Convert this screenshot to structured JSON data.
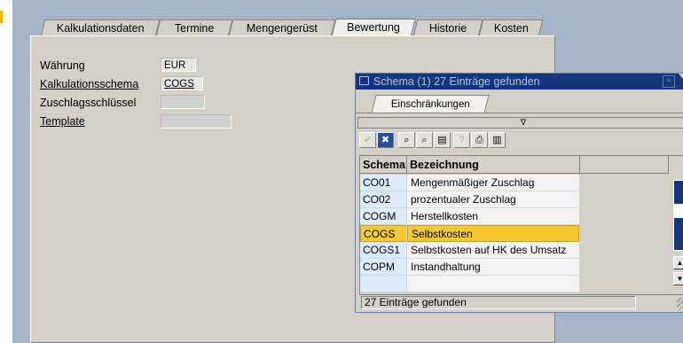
{
  "tabs": [
    {
      "label": "Kalkulationsdaten"
    },
    {
      "label": "Termine"
    },
    {
      "label": "Mengengerüst"
    },
    {
      "label": "Bewertung"
    },
    {
      "label": "Historie"
    },
    {
      "label": "Kosten"
    }
  ],
  "active_tab": "Bewertung",
  "fields": {
    "waehrung": {
      "label": "Währung",
      "value": "EUR"
    },
    "kalkulationsschema": {
      "label": "Kalkulationsschema",
      "value": "COGS"
    },
    "zuschlagsschluessel": {
      "label": "Zuschlagsschlüssel",
      "value": ""
    },
    "template": {
      "label": "Template",
      "value": ""
    }
  },
  "dialog": {
    "title": "Schema (1)  27 Einträge gefunden",
    "close_glyph": "×",
    "subtab": "Einschränkungen",
    "filter_glyph": "∇",
    "toolbar_icons": [
      "checkmark-icon",
      "cancel-icon",
      "find-icon",
      "find-next-icon",
      "sort-icon",
      "help-icon",
      "print-icon",
      "list-icon"
    ],
    "columns": [
      "Schema",
      "Bezeichnung"
    ],
    "rows": [
      {
        "code": "CO01",
        "desc": "Mengenmäßiger Zuschlag"
      },
      {
        "code": "CO02",
        "desc": "prozentualer Zuschlag"
      },
      {
        "code": "COGM",
        "desc": "Herstellkosten"
      },
      {
        "code": "COGS",
        "desc": "Selbstkosten",
        "selected": true
      },
      {
        "code": "COGS1",
        "desc": "Selbstkosten auf HK des Umsatz"
      },
      {
        "code": "COPM",
        "desc": "Instandhaltung"
      }
    ],
    "status": "27 Einträge gefunden"
  },
  "colors": {
    "background": "#a5b4c6",
    "dialog_title_bg": "#14367e",
    "selected_row": "#f6c832",
    "code_cell": "#dcecfc"
  }
}
